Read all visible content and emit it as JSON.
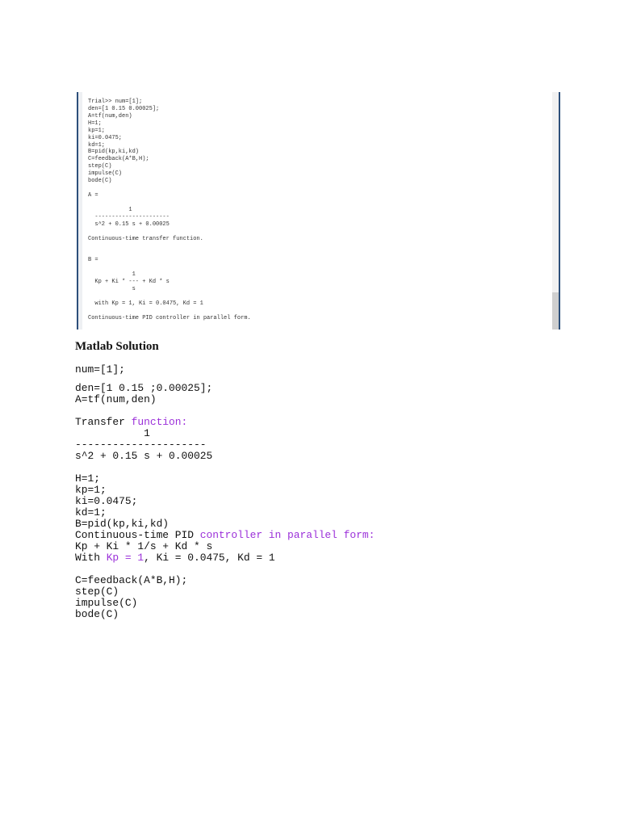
{
  "console_screenshot": {
    "lines": [
      "Trial>> num=[1];",
      "den=[1 0.15 0.00025];",
      "A=tf(num,den)",
      "H=1;",
      "kp=1;",
      "ki=0.0475;",
      "kd=1;",
      "B=pid(kp,ki,kd)",
      "C=feedback(A*B,H);",
      "step(C)",
      "impulse(C)",
      "bode(C)",
      "",
      "A =",
      "",
      "            1",
      "  ----------------------",
      "  s^2 + 0.15 s + 0.00025",
      "",
      "Continuous-time transfer function.",
      "",
      "",
      "B =",
      "",
      "             1",
      "  Kp + Ki * --- + Kd * s",
      "             s",
      "",
      "  with Kp = 1, Ki = 0.0475, Kd = 1",
      "",
      "Continuous-time PID controller in parallel form."
    ]
  },
  "heading": "Matlab Solution",
  "colors": {
    "text": "#111111",
    "purple": "#9b30d9"
  },
  "blocks": [
    [
      [
        {
          "t": "num=[1];"
        }
      ]
    ],
    [
      [
        {
          "t": "den=[1 0.15 ;0.00025];"
        }
      ],
      [
        {
          "t": "A=tf(num,den)"
        }
      ]
    ],
    [
      [
        {
          "t": "Transfer "
        },
        {
          "t": "function:",
          "c": "purple"
        }
      ],
      [
        {
          "t": "           1"
        }
      ],
      [
        {
          "t": "---------------------"
        }
      ],
      [
        {
          "t": "s^2 + 0.15 s + 0.00025"
        }
      ]
    ],
    [
      [
        {
          "t": "H=1;"
        }
      ],
      [
        {
          "t": "kp=1;"
        }
      ],
      [
        {
          "t": "ki=0.0475;"
        }
      ],
      [
        {
          "t": "kd=1;"
        }
      ],
      [
        {
          "t": "B=pid(kp,ki,kd)"
        }
      ],
      [
        {
          "t": "Continuous-time PID "
        },
        {
          "t": "controller in parallel form:",
          "c": "purple"
        }
      ],
      [
        {
          "t": "Kp + Ki * 1/s + Kd * s"
        }
      ],
      [
        {
          "t": "With "
        },
        {
          "t": "Kp = 1",
          "c": "purple"
        },
        {
          "t": ", Ki = 0.0475, Kd = 1"
        }
      ]
    ],
    [
      [
        {
          "t": "C=feedback(A*B,H);"
        }
      ],
      [
        {
          "t": "step(C)"
        }
      ],
      [
        {
          "t": "impulse(C)"
        }
      ],
      [
        {
          "t": "bode(C)"
        }
      ]
    ]
  ]
}
